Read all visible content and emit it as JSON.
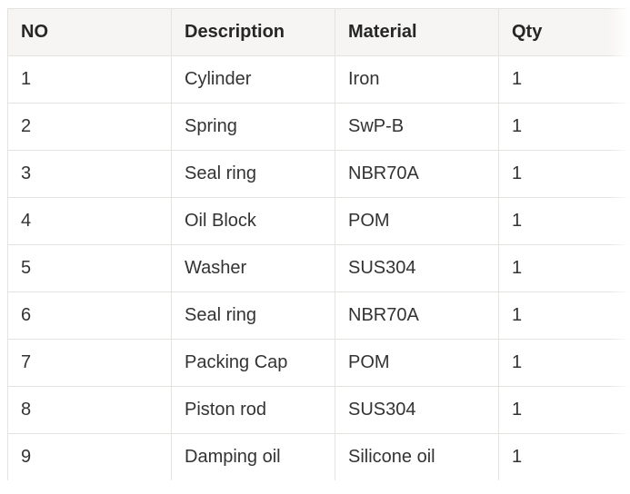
{
  "table": {
    "headers": [
      "NO",
      "Description",
      "Material",
      "Qty"
    ],
    "rows": [
      [
        "1",
        "Cylinder",
        "Iron",
        "1"
      ],
      [
        "2",
        "Spring",
        "SwP-B",
        "1"
      ],
      [
        "3",
        "Seal ring",
        "NBR70A",
        "1"
      ],
      [
        "4",
        "Oil Block",
        "POM",
        "1"
      ],
      [
        "5",
        "Washer",
        "SUS304",
        "1"
      ],
      [
        "6",
        "Seal ring",
        "NBR70A",
        "1"
      ],
      [
        "7",
        "Packing Cap",
        "POM",
        "1"
      ],
      [
        "8",
        "Piston rod",
        "SUS304",
        "1"
      ],
      [
        "9",
        "Damping oil",
        "Silicone oil",
        "1"
      ]
    ]
  },
  "colors": {
    "header_background": "#f6f5f3",
    "border": "#e5e3df",
    "text": "#333333"
  }
}
